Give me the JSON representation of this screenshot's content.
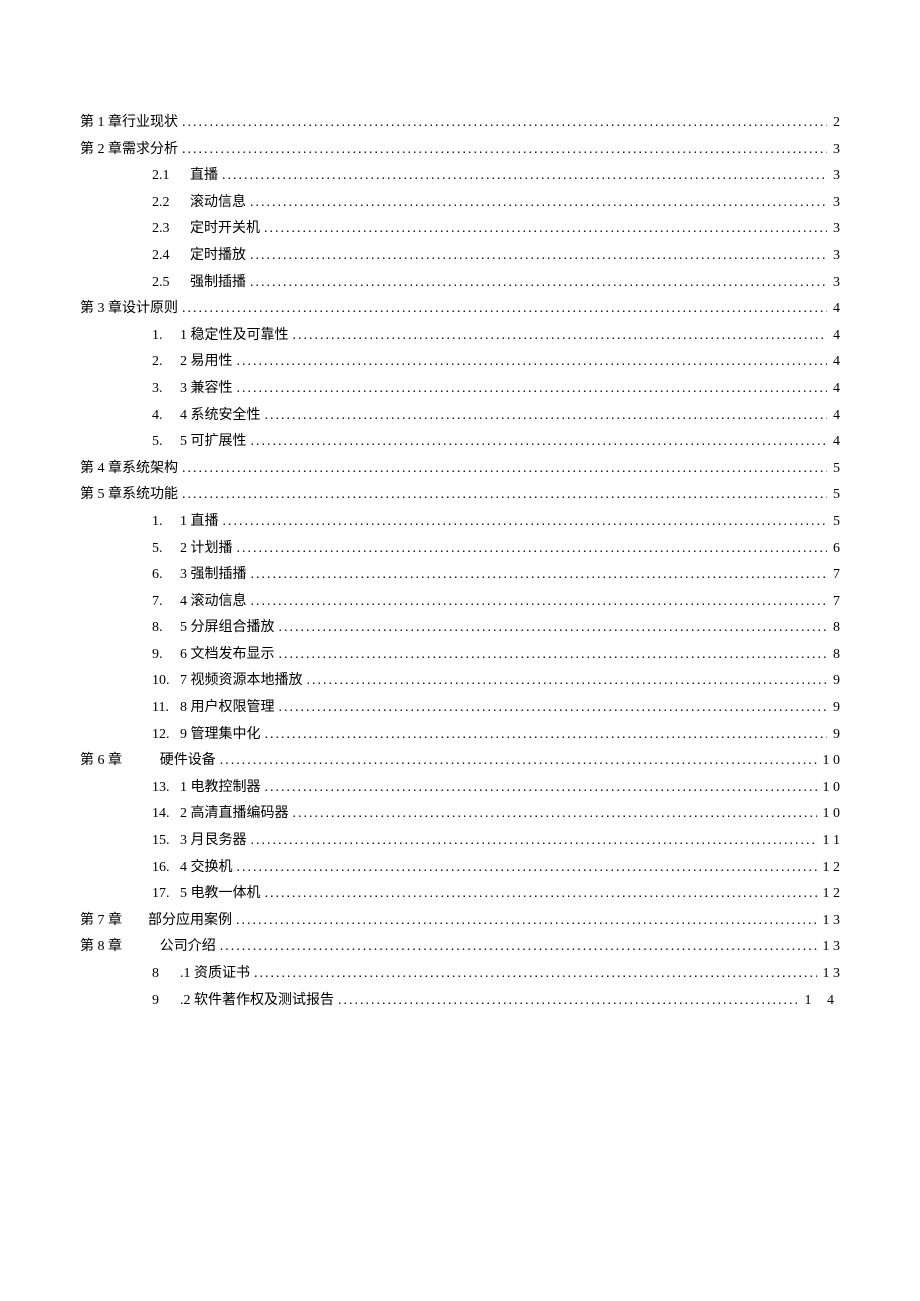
{
  "toc": {
    "c1": {
      "label": "第 1 章行业现状",
      "page": "2"
    },
    "c2": {
      "label": "第 2 章需求分析",
      "page": "3"
    },
    "s2_1": {
      "num": "2.1",
      "title": "直播",
      "page": "3"
    },
    "s2_2": {
      "num": "2.2",
      "title": "滚动信息",
      "page": "3"
    },
    "s2_3": {
      "num": "2.3",
      "title": "定时开关机",
      "page": "3"
    },
    "s2_4": {
      "num": "2.4",
      "title": "定时播放",
      "page": "3"
    },
    "s2_5": {
      "num": "2.5",
      "title": "强制插播",
      "page": "3"
    },
    "c3": {
      "label": "第 3 章设计原则",
      "page": "4"
    },
    "s3_1": {
      "num": "1.",
      "title": "1 稳定性及可靠性",
      "page": "4"
    },
    "s3_2": {
      "num": "2.",
      "title": "2 易用性",
      "page": "4"
    },
    "s3_3": {
      "num": "3.",
      "title": "3 兼容性",
      "page": "4"
    },
    "s3_4": {
      "num": "4.",
      "title": "4 系统安全性",
      "page": "4"
    },
    "s3_5": {
      "num": "5.",
      "title": "5 可扩展性",
      "page": "4"
    },
    "c4": {
      "label": "第 4 章系统架构",
      "page": "5"
    },
    "c5": {
      "label": "第 5 章系统功能",
      "page": "5"
    },
    "s5_1": {
      "num": "1.",
      "title": "1 直播",
      "page": "5"
    },
    "s5_2": {
      "num": "5.",
      "title": "2 计划播",
      "page": "6"
    },
    "s5_3": {
      "num": "6.",
      "title": "3 强制插播",
      "page": "7"
    },
    "s5_4": {
      "num": "7.",
      "title": "4 滚动信息",
      "page": "7"
    },
    "s5_5": {
      "num": "8.",
      "title": "5 分屏组合播放",
      "page": "8"
    },
    "s5_6": {
      "num": "9.",
      "title": "6 文档发布显示",
      "page": "8"
    },
    "s5_7": {
      "num": "10.",
      "title": "7 视频资源本地播放",
      "page": "9"
    },
    "s5_8": {
      "num": "11.",
      "title": "8 用户权限管理",
      "page": "9"
    },
    "s5_9": {
      "num": "12.",
      "title": "9 管理集中化",
      "page": "9"
    },
    "c6": {
      "chapter": "第 6 章",
      "title": "硬件设备",
      "page": "1 0"
    },
    "s6_1": {
      "num": "13.",
      "title": "1 电教控制器 ",
      "page": "1 0"
    },
    "s6_2": {
      "num": "14.",
      "title": "2 高清直播编码器 ",
      "page": "1 0"
    },
    "s6_3": {
      "num": "15.",
      "title": "3 月艮务器 ",
      "page": "1 1"
    },
    "s6_4": {
      "num": "16.",
      "title": "4 交换机 ",
      "page": "1 2"
    },
    "s6_5": {
      "num": "17.",
      "title": "5 电教一体机 ",
      "page": "1 2"
    },
    "c7": {
      "chapter": "第 7 章",
      "title": "部分应用案例",
      "page": "1 3"
    },
    "c8": {
      "chapter": "第 8 章",
      "title": "公司介绍",
      "page": "1 3"
    },
    "s8_1": {
      "num": "8",
      "title": ".1 资质证书",
      "page": "1 3"
    },
    "s8_2": {
      "num": "9",
      "title": ".2 软件著作权及测试报告",
      "page": "1  4"
    }
  }
}
